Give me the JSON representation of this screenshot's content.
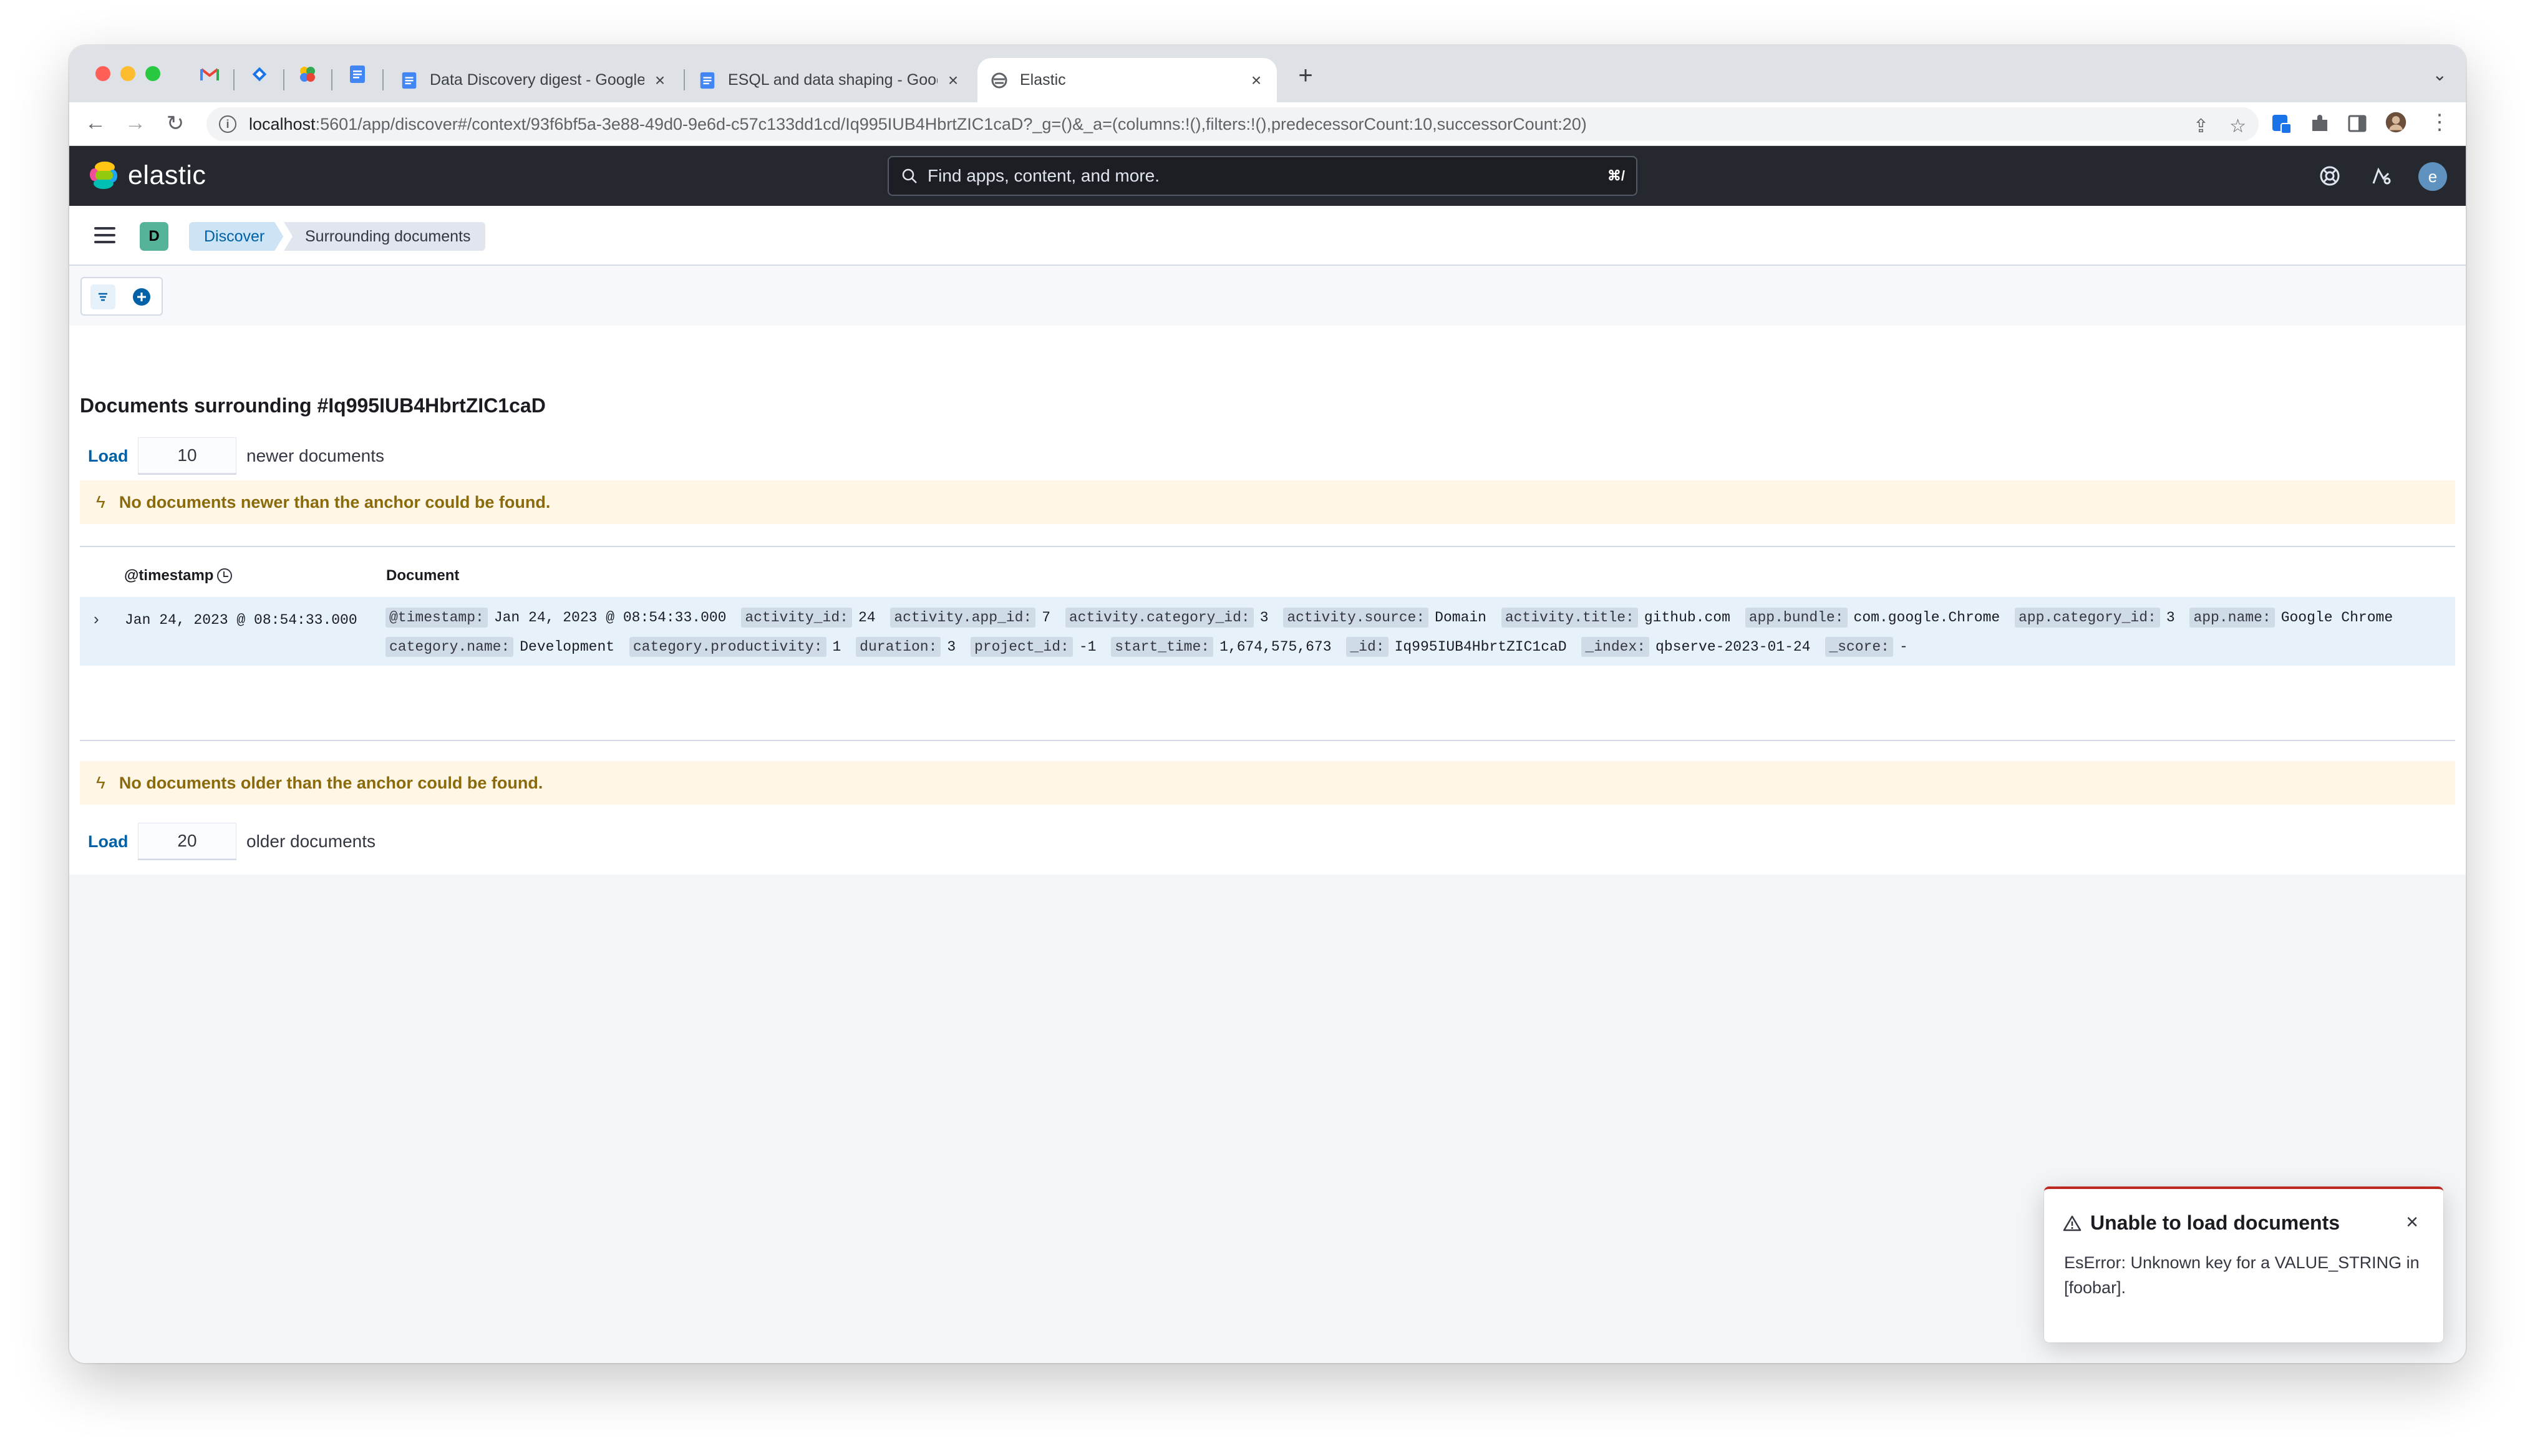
{
  "browser": {
    "tabs": [
      {
        "title": "Data Discovery digest - Google",
        "close": "×"
      },
      {
        "title": "ESQL and data shaping - Goog",
        "close": "×"
      },
      {
        "title": "Elastic",
        "close": "×"
      }
    ],
    "new_tab": "+",
    "tab_menu": "⌄",
    "url_host": "localhost",
    "url_path": ":5601/app/discover#/context/93f6bf5a-3e88-49d0-9e6d-c57c133dd1cd/Iq995IUB4HbrtZIC1caD?_g=()&_a=(columns:!(),filters:!(),predecessorCount:10,successorCount:20)",
    "info_icon": "i"
  },
  "header": {
    "logo_text": "elastic",
    "search_placeholder": "Find apps, content, and more.",
    "search_shortcut": "⌘/",
    "avatar_initial": "e"
  },
  "breadcrumbs": {
    "space_initial": "D",
    "items": [
      "Discover",
      "Surrounding documents"
    ]
  },
  "main": {
    "title": "Documents surrounding #Iq995IUB4HbrtZIC1caD",
    "newer": {
      "load_label": "Load",
      "count": "10",
      "suffix": "newer documents"
    },
    "newer_callout": "No documents newer than the anchor could be found.",
    "columns": {
      "timestamp": "@timestamp",
      "document": "Document"
    },
    "row": {
      "timestamp": "Jan 24, 2023 @ 08:54:33.000",
      "fields": [
        {
          "key": "@timestamp:",
          "value": "Jan 24, 2023 @ 08:54:33.000"
        },
        {
          "key": "activity_id:",
          "value": "24"
        },
        {
          "key": "activity.app_id:",
          "value": "7"
        },
        {
          "key": "activity.category_id:",
          "value": "3"
        },
        {
          "key": "activity.source:",
          "value": "Domain"
        },
        {
          "key": "activity.title:",
          "value": "github.com"
        },
        {
          "key": "app.bundle:",
          "value": "com.google.Chrome"
        },
        {
          "key": "app.category_id:",
          "value": "3"
        },
        {
          "key": "app.name:",
          "value": "Google Chrome"
        },
        {
          "key": "category.name:",
          "value": "Development"
        },
        {
          "key": "category.productivity:",
          "value": "1"
        },
        {
          "key": "duration:",
          "value": "3"
        },
        {
          "key": "project_id:",
          "value": "-1"
        },
        {
          "key": "start_time:",
          "value": "1,674,575,673"
        },
        {
          "key": "_id:",
          "value": "Iq995IUB4HbrtZIC1caD"
        },
        {
          "key": "_index:",
          "value": "qbserve-2023-01-24"
        },
        {
          "key": "_score:",
          "value": "-"
        }
      ]
    },
    "older_callout": "No documents older than the anchor could be found.",
    "older": {
      "load_label": "Load",
      "count": "20",
      "suffix": "older documents"
    }
  },
  "toast": {
    "title": "Unable to load documents",
    "body": "EsError: Unknown key for a VALUE_STRING in [foobar].",
    "close": "×"
  },
  "colors": {
    "accent": "#0061a6",
    "header": "#25282f",
    "warning_bg": "#fef6e6",
    "danger": "#bd271e"
  }
}
